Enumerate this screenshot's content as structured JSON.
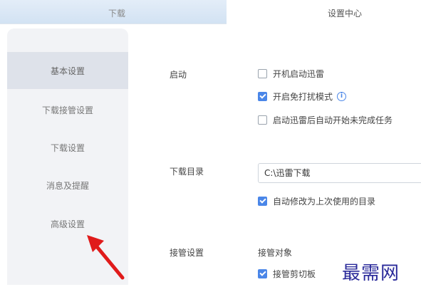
{
  "tabs": {
    "download": "下载",
    "settings_center": "设置中心"
  },
  "sidebar": {
    "items": [
      {
        "label": "基本设置",
        "active": true
      },
      {
        "label": "下载接管设置",
        "active": false
      },
      {
        "label": "下载设置",
        "active": false
      },
      {
        "label": "消息及提醒",
        "active": false
      },
      {
        "label": "高级设置",
        "active": false
      }
    ]
  },
  "startup": {
    "label": "启动",
    "options": [
      {
        "label": "开机启动迅雷",
        "checked": false
      },
      {
        "label": "开启免打扰模式",
        "checked": true
      },
      {
        "label": "启动迅雷后自动开始未完成任务",
        "checked": false
      }
    ]
  },
  "download_dir": {
    "label": "下载目录",
    "path": "C:\\迅雷下载",
    "auto_modify": {
      "label": "自动修改为上次使用的目录",
      "checked": true
    }
  },
  "takeover": {
    "label": "接管设置",
    "object_label": "接管对象",
    "clipboard": {
      "label": "接管剪切板",
      "checked": true
    }
  },
  "watermark": "最需网",
  "colors": {
    "accent": "#4a86e8",
    "arrow": "#e01b1b",
    "sidebar_bg": "#f2f3f6",
    "sidebar_active": "#dee2ea"
  },
  "icons": {
    "info": "info-icon",
    "annotation": "red-arrow-annotation"
  }
}
